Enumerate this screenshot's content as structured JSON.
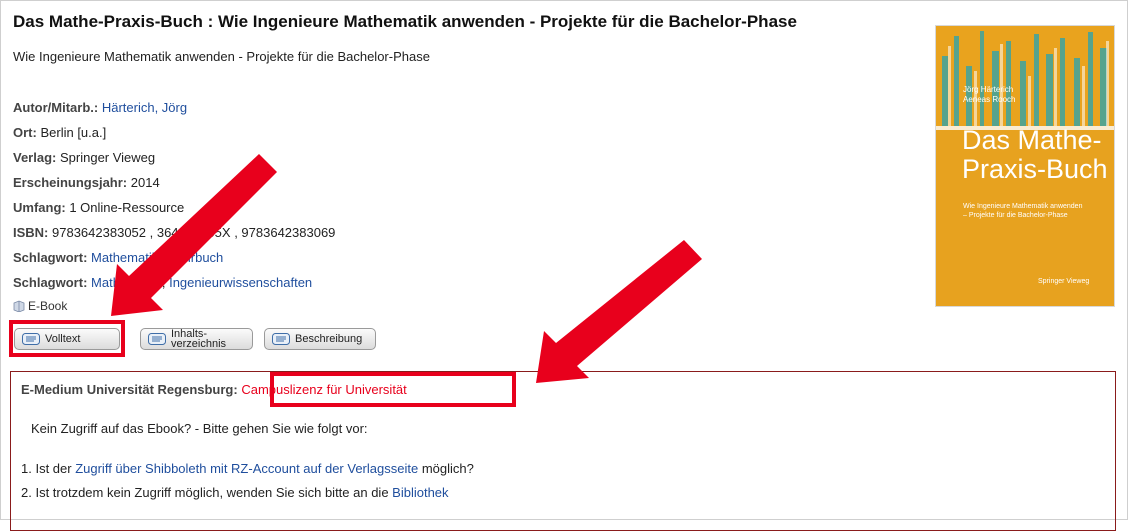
{
  "record": {
    "title": "Das Mathe-Praxis-Buch :  Wie Ingenieure Mathematik anwenden - Projekte für die Bachelor-Phase",
    "subtitle": "Wie Ingenieure Mathematik anwenden - Projekte für die Bachelor-Phase"
  },
  "meta": {
    "author_label": "Autor/Mitarb.:",
    "author_value": "Härterich, Jörg",
    "place_label": "Ort:",
    "place_value": "Berlin [u.a.]",
    "publisher_label": "Verlag:",
    "publisher_value": "Springer Vieweg",
    "year_label": "Erscheinungsjahr:",
    "year_value": "2014",
    "extent_label": "Umfang:",
    "extent_value": "1 Online-Ressource",
    "isbn_label": "ISBN:",
    "isbn_value": "9783642383052 , 364238305X , 9783642383069",
    "subject1_label": "Schlagwort:",
    "subject1_link1": "Mathematik",
    "subject1_sep": " ; ",
    "subject1_link2": "Lehrbuch",
    "subject2_label": "Schlagwort:",
    "subject2_link1": "Mathematik",
    "subject2_sep": " ; ",
    "subject2_link2": "Ingenieurwissenschaften",
    "format": "E-Book"
  },
  "buttons": {
    "fulltext": "Volltext",
    "toc_line1": "Inhalts-",
    "toc_line2": "verzeichnis",
    "description": "Beschreibung"
  },
  "access": {
    "institution": "E-Medium Universität Regensburg:",
    "license": "Campuslizenz für Universität",
    "no_access": "Kein Zugriff auf das Ebook? - Bitte gehen Sie wie folgt vor:",
    "step1_prefix": "1. Ist der ",
    "step1_link": "Zugriff über Shibboleth mit RZ-Account auf der Verlagsseite",
    "step1_suffix": " möglich?",
    "step2_prefix": "2. Ist trotzdem kein Zugriff möglich, wenden Sie sich bitte an die ",
    "step2_link": "Bibliothek"
  },
  "cover": {
    "authors_line1": "Jörg Härterich",
    "authors_line2": "Aeneas Rooch",
    "title_line1": "Das Mathe-",
    "title_line2": "Praxis-Buch",
    "desc": "Wie Ingenieure Mathematik anwenden – Projekte für die Bachelor-Phase",
    "publisher": "Springer Vieweg"
  },
  "colors": {
    "link": "#1f4e9d",
    "highlight": "#e8001c",
    "cover": "#e7a21f",
    "panel_border": "#8a1b1b"
  }
}
